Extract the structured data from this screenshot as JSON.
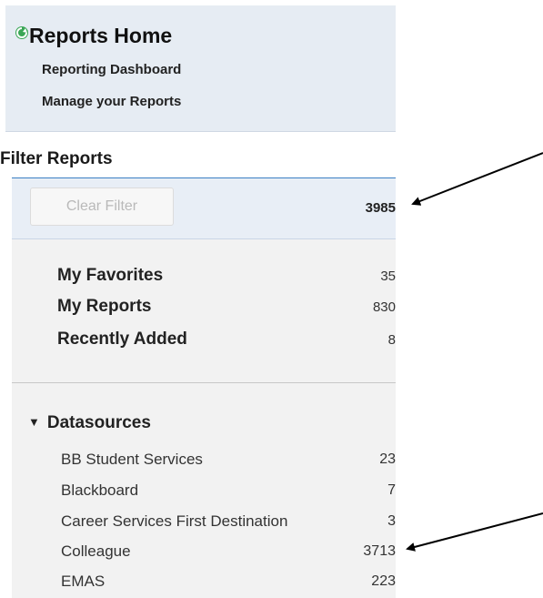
{
  "header": {
    "title": "Reports Home",
    "links": [
      "Reporting Dashboard",
      "Manage your Reports"
    ]
  },
  "filter": {
    "title": "Filter Reports",
    "clear_label": "Clear Filter",
    "total": "3985"
  },
  "favorites": [
    {
      "label": "My Favorites",
      "count": "35"
    },
    {
      "label": "My Reports",
      "count": "830"
    },
    {
      "label": "Recently Added",
      "count": "8"
    }
  ],
  "datasources": {
    "title": "Datasources",
    "items": [
      {
        "label": "BB Student Services",
        "count": "23"
      },
      {
        "label": "Blackboard",
        "count": "7"
      },
      {
        "label": "Career Services First Destination",
        "count": "3"
      },
      {
        "label": "Colleague",
        "count": "3713"
      },
      {
        "label": "EMAS",
        "count": "223"
      }
    ]
  },
  "colors": {
    "accent": "#3b7fc4",
    "logo": "#3aa655",
    "header_bg": "#e6ecf3"
  },
  "icons": [
    "refresh-logo-icon",
    "caret-down-icon",
    "arrow-icon"
  ]
}
